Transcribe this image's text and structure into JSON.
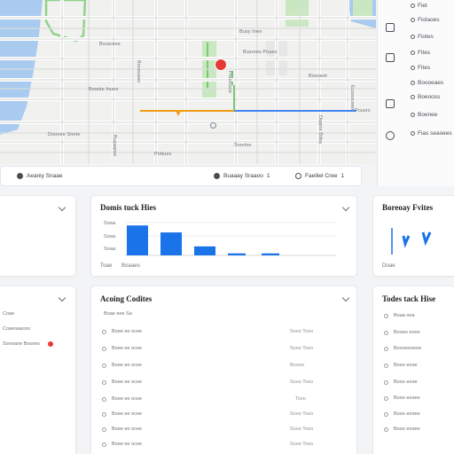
{
  "map": {
    "labels": [
      "Bouesiee",
      "Busy Inee",
      "Boaste Inues",
      "Busrees Pnaes",
      "Doonee Snete",
      "Bosoeet",
      "Srevtne",
      "Pottues",
      "Bousuees",
      "Busaaree",
      "Dwane Bdes",
      "Euosoceen",
      "Pouvusce",
      "Pousrs"
    ]
  },
  "rail": {
    "items": [
      "Fiet",
      "Fiolaoes",
      "Fiotes",
      "Fites",
      "Fites",
      "Boooeaes",
      "Boeooss",
      "Boenee",
      "Fias seaoees"
    ]
  },
  "strip": {
    "left_label": "Aeaniy Snaae",
    "mid_label": "Buaaay Sraaoo",
    "mid_count": "1",
    "right_label": "Faeiliel Cree",
    "right_count": "1"
  },
  "cards": {
    "domis": {
      "title": "Domis tuck Hies",
      "tick_top": "Soaa",
      "tick_mid": "Soaa",
      "tick_bot": "Soaa",
      "footer_a": "Toae",
      "footer_b": "Boaaes"
    },
    "right_top": {
      "title": "Boreoay Fvites",
      "footer": "Doae"
    },
    "left_mid": {
      "rows": [
        "Coae",
        "Coaeoaaces",
        "Soooane Bosnes"
      ]
    },
    "accts": {
      "title": "Acoing Codites",
      "header": "Boae eee Sa",
      "rows": [
        {
          "label": "Boee ee ocee",
          "value": "Sooo Tooo"
        },
        {
          "label": "Boee ee ocee",
          "value": "Sooo Tooo"
        },
        {
          "label": "Boee ee ocee",
          "value": "Boooo"
        },
        {
          "label": "Boee ee ocee",
          "value": "Sooo Tooo"
        },
        {
          "label": "Boee ee ocee",
          "value": "Tooo"
        },
        {
          "label": "Boee ee ocee",
          "value": "Sooo Tooo"
        },
        {
          "label": "Boee ee ocee",
          "value": "Sooo Tooo"
        },
        {
          "label": "Boee ee ocee",
          "value": "Sooo Tooo"
        }
      ]
    },
    "today": {
      "title": "Todes tack Hise",
      "rows": [
        "Boaa ooa",
        "Booeo eooe",
        "Boooeooeee",
        "Booo eooe",
        "Booo eooe",
        "Booo eooee",
        "Booo eooee",
        "Booo eooee"
      ]
    }
  },
  "chart_data": {
    "type": "bar",
    "categories": [
      "",
      "",
      "",
      "",
      ""
    ],
    "values": [
      30,
      23,
      9,
      2,
      2
    ],
    "ylim": [
      0,
      40
    ],
    "title": "Domis tuck Hies"
  },
  "colors": {
    "accent": "#1a73e8",
    "pin": "#e53935",
    "park": "#c9e7c0",
    "water": "#a8cbef",
    "route_orange": "#f39c12",
    "route_blue": "#4285f4"
  }
}
